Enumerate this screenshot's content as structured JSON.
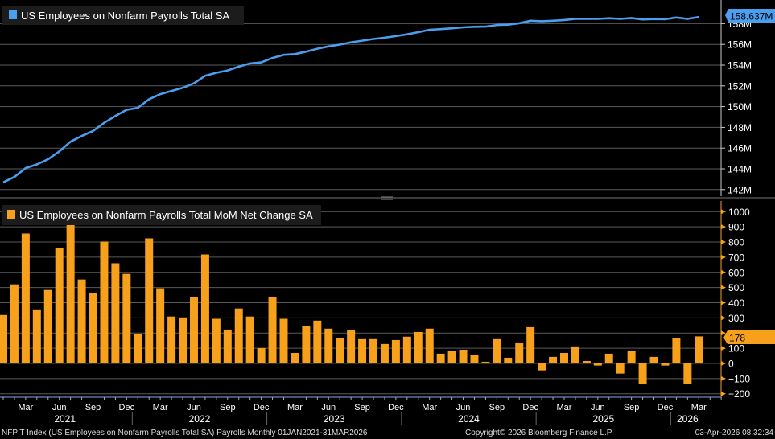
{
  "chart_data": [
    {
      "type": "line",
      "legend": "US Employees on Nonfarm Payrolls Total SA",
      "color": "#4a9ff0",
      "ylim": [
        141.5,
        158.9
      ],
      "yticks": [
        142,
        144,
        146,
        148,
        150,
        152,
        154,
        156,
        158
      ],
      "ytick_labels": [
        "142M",
        "144M",
        "146M",
        "148M",
        "150M",
        "152M",
        "154M",
        "156M",
        "158M"
      ],
      "last_value_label": "158.637M",
      "grid": true,
      "values": [
        142.7,
        143.22,
        144.08,
        144.43,
        144.92,
        145.68,
        146.62,
        147.17,
        147.64,
        148.44,
        149.1,
        149.69,
        149.88,
        150.71,
        151.2,
        151.51,
        151.81,
        152.25,
        152.97,
        153.26,
        153.49,
        153.85,
        154.16,
        154.26,
        154.69,
        154.99,
        155.06,
        155.3,
        155.58,
        155.81,
        155.98,
        156.2,
        156.36,
        156.52,
        156.64,
        156.8,
        156.97,
        157.18,
        157.41,
        157.47,
        157.55,
        157.64,
        157.7,
        157.71,
        157.87,
        157.9,
        158.04,
        158.28,
        158.23,
        158.28,
        158.35,
        158.46,
        158.47,
        158.46,
        158.52,
        158.46,
        158.54,
        158.4,
        158.44,
        158.43,
        158.59,
        158.46,
        158.637
      ]
    },
    {
      "type": "bar",
      "legend": "US Employees on Nonfarm Payrolls Total MoM Net Change SA",
      "color": "#f7a01c",
      "ylim": [
        -220,
        1050
      ],
      "yticks": [
        -200,
        -100,
        0,
        100,
        200,
        300,
        400,
        500,
        600,
        700,
        800,
        900,
        1000
      ],
      "ytick_labels": [
        "-200",
        "-100",
        "0",
        "100",
        "",
        "300",
        "400",
        "500",
        "600",
        "700",
        "800",
        "900",
        "1000"
      ],
      "last_value_label": "178",
      "grid": true,
      "values": [
        319,
        521,
        856,
        356,
        484,
        761,
        941,
        553,
        463,
        803,
        660,
        590,
        193,
        824,
        495,
        309,
        303,
        436,
        718,
        294,
        223,
        362,
        309,
        101,
        436,
        294,
        69,
        245,
        282,
        229,
        165,
        218,
        160,
        160,
        128,
        154,
        176,
        207,
        229,
        64,
        80,
        90,
        53,
        11,
        160,
        37,
        138,
        239,
        -46,
        43,
        69,
        112,
        16,
        -14,
        64,
        -67,
        80,
        -138,
        43,
        -14,
        165,
        -133,
        178
      ]
    }
  ],
  "x_axis": {
    "start": "2021-01",
    "end": "2026-03",
    "month_labels": [
      "Mar",
      "Jun",
      "Sep",
      "Dec"
    ],
    "years": [
      "2021",
      "2022",
      "2023",
      "2024",
      "2025",
      "2026"
    ]
  },
  "footer": {
    "description": "NFP T Index (US Employees on Nonfarm Payrolls Total SA) Payrolls Monthly 01JAN2021-31MAR2026",
    "copyright": "Copyright© 2026 Bloomberg Finance L.P.",
    "timestamp": "03-Apr-2026 08:32:34"
  }
}
